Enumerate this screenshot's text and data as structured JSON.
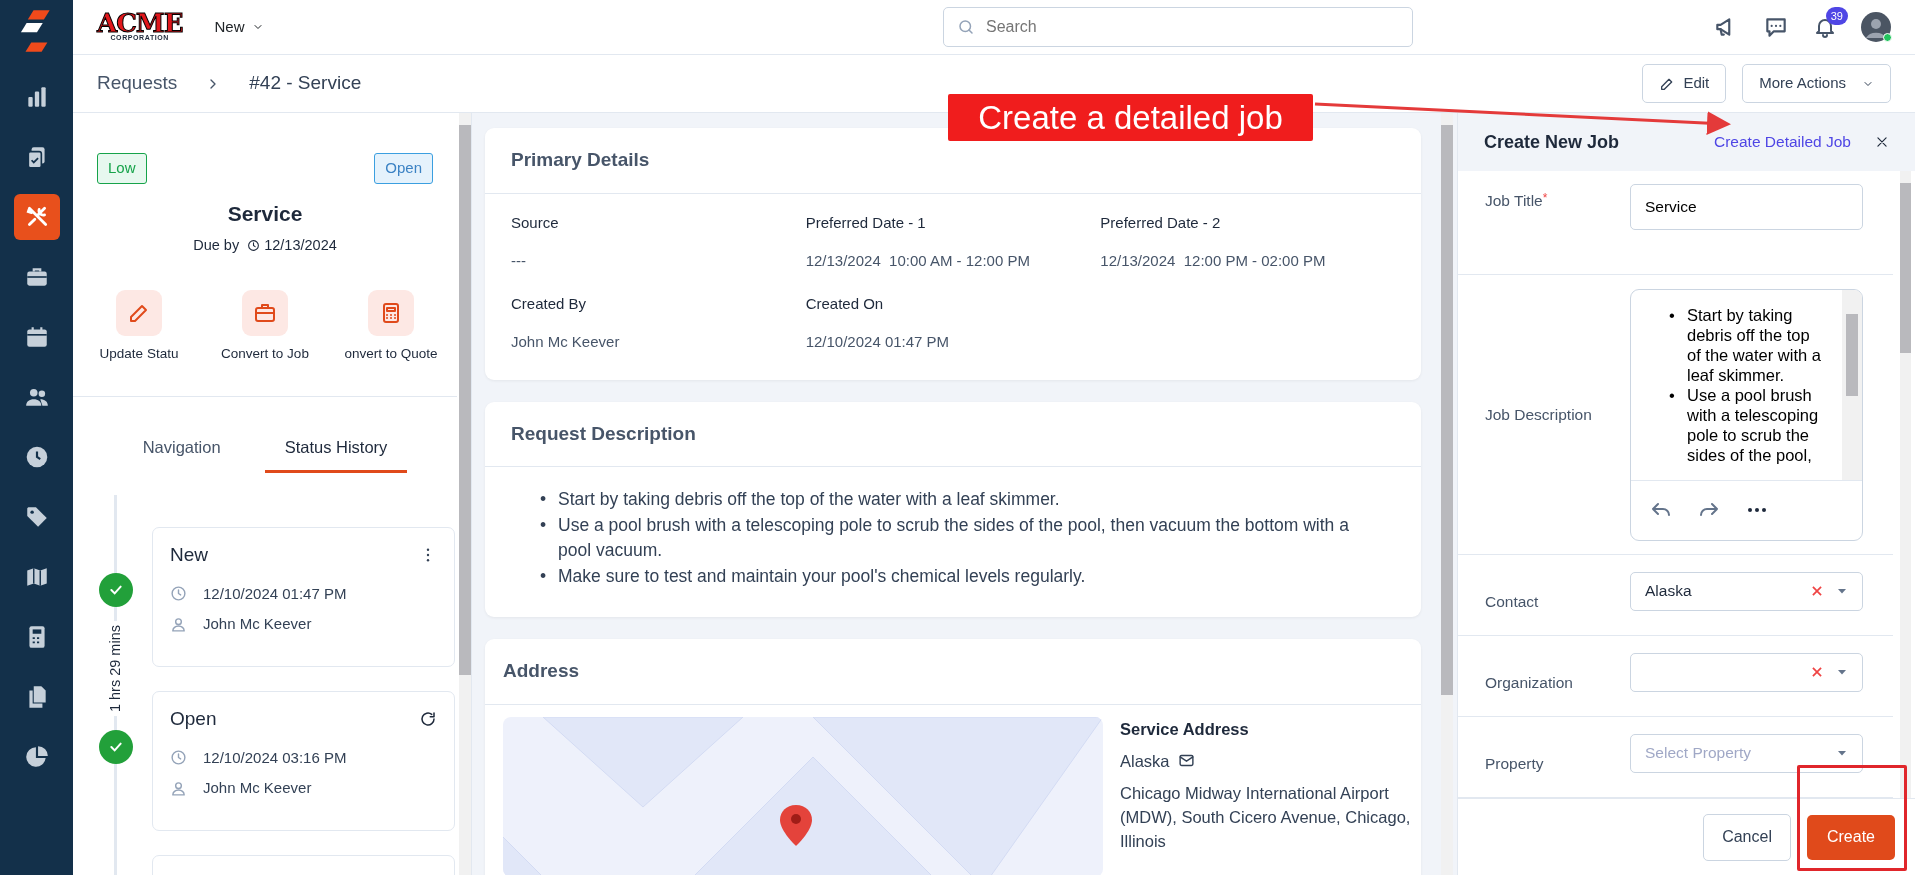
{
  "logo": {
    "title": "ACME",
    "subtitle": "CORPORATION"
  },
  "sidebar": {
    "items": [
      {
        "selected": false
      },
      {
        "selected": false
      },
      {
        "selected": true
      },
      {
        "selected": false
      },
      {
        "selected": false
      },
      {
        "selected": false
      },
      {
        "selected": false
      },
      {
        "selected": false
      },
      {
        "selected": false
      },
      {
        "selected": false
      },
      {
        "selected": false
      },
      {
        "selected": false
      }
    ]
  },
  "topbar": {
    "menu": "New",
    "search": {
      "placeholder": "Search"
    },
    "notifications": "39",
    "online": true
  },
  "breadcrumb": [
    "Requests",
    "#42 - Service"
  ],
  "page_actions": {
    "edit": "Edit",
    "more": "More Actions"
  },
  "request": {
    "priority": "Low",
    "status": "Open",
    "title": "Service",
    "due_label": "Due by",
    "due_date": "12/13/2024",
    "actions": [
      "Update Statu",
      "Convert to Job",
      "onvert to Quote"
    ]
  },
  "left_tabs": [
    {
      "label": "Navigation",
      "selected": false
    },
    {
      "label": "Status History",
      "selected": true
    }
  ],
  "status_history": {
    "duration": "1 hrs 29 mins",
    "entries": [
      {
        "status": "New",
        "time": "12/10/2024 01:47 PM",
        "user": "John Mc Keever",
        "completed": true
      },
      {
        "status": "Open",
        "time": "12/10/2024 03:16 PM",
        "user": "John Mc Keever",
        "completed": true
      }
    ]
  },
  "primary_details": {
    "title": "Primary Details",
    "fields": [
      {
        "label": "Source",
        "value": "---"
      },
      {
        "label": "Preferred Date - 1",
        "value": "12/13/2024  10:00 AM - 12:00 PM"
      },
      {
        "label": "Preferred Date - 2",
        "value": "12/13/2024  12:00 PM - 02:00 PM"
      },
      {
        "label": "Created By",
        "value": "John Mc Keever"
      },
      {
        "label": "Created On",
        "value": "12/10/2024 01:47 PM"
      }
    ]
  },
  "request_description": {
    "title": "Request Description",
    "bullet": "•",
    "items": [
      "Start by taking debris off the top of the water with a leaf skimmer.",
      "Use a pool brush with a telescoping pole to scrub the sides of the pool, then vacuum the bottom with a pool vacuum.",
      "Make sure to test and maintain your pool's chemical levels regularly."
    ]
  },
  "address": {
    "title": "Address",
    "heading": "Service Address",
    "contact": "Alaska",
    "text": "Chicago Midway International Airport (MDW), South Cicero Avenue, Chicago, Illinois"
  },
  "create_job": {
    "title": "Create New Job",
    "link": "Create Detailed Job",
    "required_mark": "*",
    "fields": [
      {
        "kind": "text",
        "label": "Job Title",
        "required": true,
        "value": "Service"
      },
      {
        "kind": "editor",
        "label": "Job Description",
        "required": false,
        "bullet": "•",
        "items": [
          "Start by taking debris off the top of the water with a leaf skimmer.",
          "Use a pool brush with a telescoping pole to scrub the sides of the pool,"
        ]
      },
      {
        "kind": "select",
        "label": "Contact",
        "required": false,
        "value": "Alaska",
        "clearable": true
      },
      {
        "kind": "select",
        "label": "Organization",
        "required": false,
        "clearable": true
      },
      {
        "kind": "select",
        "label": "Property",
        "required": false,
        "placeholder": "Select Property",
        "clearable": false
      }
    ],
    "buttons": {
      "cancel": "Cancel",
      "create": "Create"
    }
  },
  "annotation": {
    "text": "Create a detailed job"
  }
}
